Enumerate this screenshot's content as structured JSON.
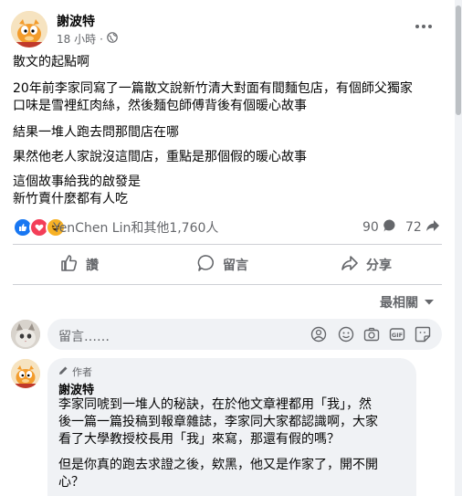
{
  "post": {
    "author": "謝波特",
    "time": "18 小時",
    "separator": "·",
    "lines": [
      "散文的起點啊",
      "20年前李家同寫了一篇散文說新竹清大對面有間麵包店，有個師父獨家",
      "口味是雪裡紅肉絲，然後麵包師傅背後有個暖心故事",
      "結果一堆人跑去問那間店在哪",
      "果然他老人家說沒這間店，重點是那個假的暖心故事",
      "這個故事給我的啟發是",
      "新竹賣什麼都有人吃"
    ]
  },
  "reactions": {
    "names": "YenChen Lin和其他1,760人",
    "comments": "90",
    "shares": "72",
    "types": [
      "like-icon",
      "love-icon",
      "haha-icon"
    ],
    "colors": {
      "like": "#1877f2",
      "love": "#f33e58",
      "haha": "#f7b125"
    }
  },
  "actions": {
    "like": "讚",
    "comment": "留言",
    "share": "分享"
  },
  "sort": {
    "label": "最相關"
  },
  "composer": {
    "placeholder": "留言……",
    "icons": [
      "sticker-icon",
      "emoji-icon",
      "camera-icon",
      "gif-icon",
      "sticker-face-icon"
    ]
  },
  "reply": {
    "badge": "作者",
    "name": "謝波特",
    "lines": [
      "李家同唬到一堆人的秘訣，在於他文章裡都用「我」，然",
      "後一篇一篇投稿到報章雜誌，李家同大家都認識啊，大家",
      "看了大學教授校長用「我」來寫，那還有假的嗎？",
      "但是你真的跑去求證之後，欸黑，他又是作家了，開不開",
      "心？"
    ]
  },
  "theme": {
    "text": "#050505",
    "secondary": "#65676b",
    "divider": "#ced0d4",
    "bubble": "#f0f2f5"
  }
}
